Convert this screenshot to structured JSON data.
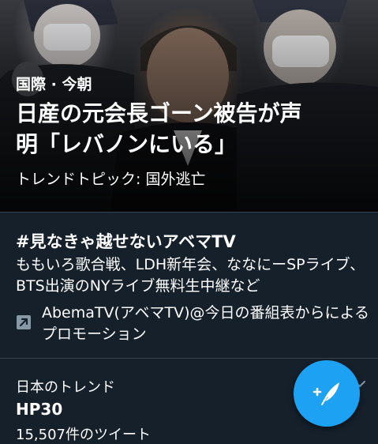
{
  "hero": {
    "meta": "国際 · 今朝",
    "title_line1": "日産の元会長ゴーン被告が声",
    "title_line2": "明「レバノンにいる」",
    "topic": "トレンドトピック: 国外逃亡"
  },
  "promoted": {
    "hashtag": "#見なきゃ越せないアベマTV",
    "description": "ももいろ歌合戦、LDH新年会、ななにーSPライブ、BTS出演のNYライブ無料生中継など",
    "promoted_by_line1": "AbemaTV(アベマTV)@今日の番組表からによる",
    "promoted_by_line2": "プロモーション",
    "icon": "promoted-arrow-icon"
  },
  "trend": {
    "location": "日本のトレンド",
    "name": "HP30",
    "tweet_count": "15,507件のツイート"
  },
  "fab": {
    "icon": "compose-tweet-icon",
    "accent": "#1da1f2"
  },
  "colors": {
    "background": "#15202b",
    "divider": "#38444d",
    "text": "#ffffff"
  }
}
